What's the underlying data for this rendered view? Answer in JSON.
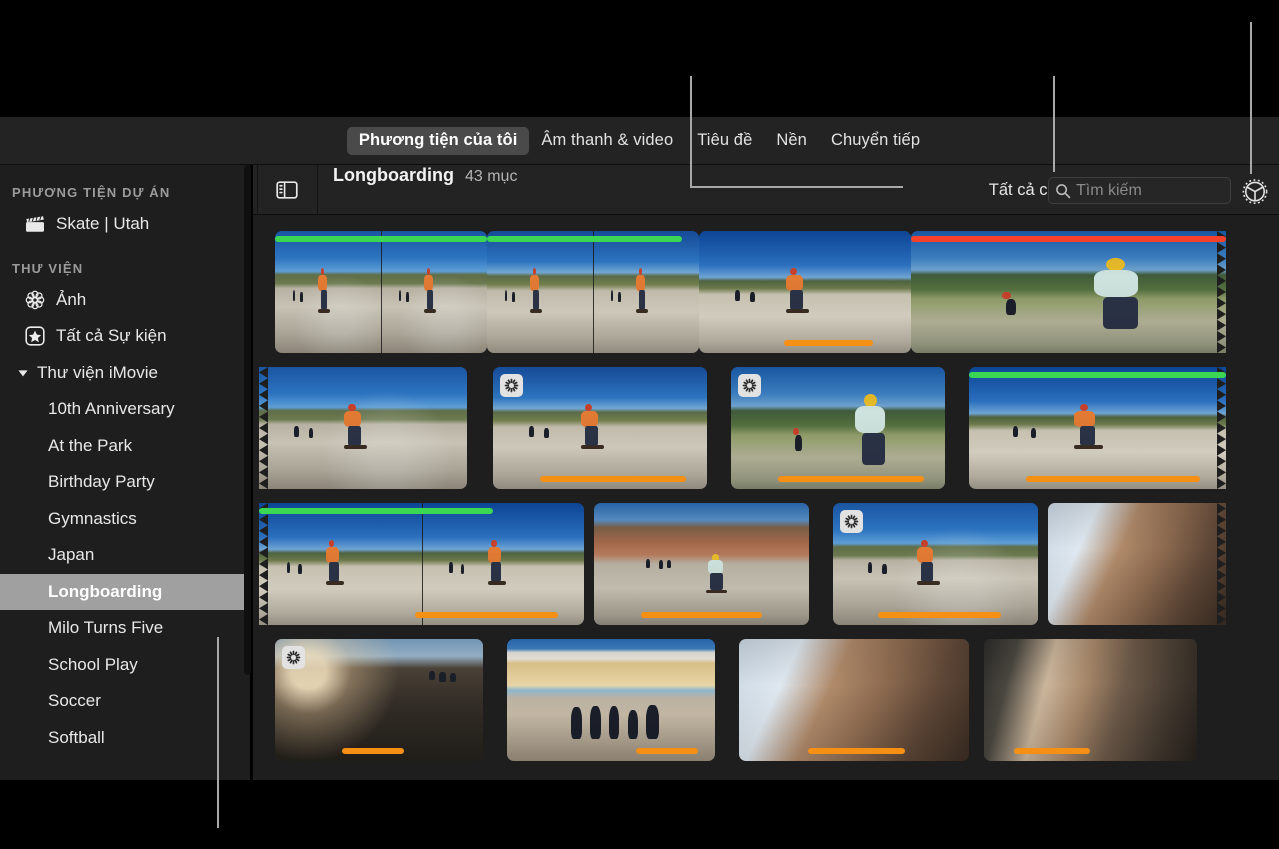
{
  "app": "iMovie media browser",
  "tab_bar": {
    "tabs": [
      {
        "label": "Phương tiện của tôi",
        "selected": true
      },
      {
        "label": "Âm thanh & video",
        "selected": false
      },
      {
        "label": "Tiêu đề",
        "selected": false
      },
      {
        "label": "Nền",
        "selected": false
      },
      {
        "label": "Chuyển tiếp",
        "selected": false
      }
    ]
  },
  "sidebar": {
    "sections": [
      {
        "header": "PHƯƠNG TIỆN DỰ ÁN",
        "items": [
          {
            "label": "Skate | Utah",
            "icon": "clapperboard-icon",
            "selected": false,
            "indent": "top"
          }
        ]
      },
      {
        "header": "THƯ VIỆN",
        "items": [
          {
            "label": "Ảnh",
            "icon": "photos-flower-icon",
            "selected": false,
            "indent": "top"
          },
          {
            "label": "Tất cả Sự kiện",
            "icon": "star-events-icon",
            "selected": false,
            "indent": "top"
          },
          {
            "label": "Thư viện iMovie",
            "icon": "disclosure-triangle-down-icon",
            "selected": false,
            "indent": "group"
          },
          {
            "label": "10th Anniversary",
            "icon": "",
            "selected": false,
            "indent": "child"
          },
          {
            "label": "At the Park",
            "icon": "",
            "selected": false,
            "indent": "child"
          },
          {
            "label": "Birthday Party",
            "icon": "",
            "selected": false,
            "indent": "child"
          },
          {
            "label": "Gymnastics",
            "icon": "",
            "selected": false,
            "indent": "child"
          },
          {
            "label": "Japan",
            "icon": "",
            "selected": false,
            "indent": "child"
          },
          {
            "label": "Longboarding",
            "icon": "",
            "selected": true,
            "indent": "child"
          },
          {
            "label": "Milo Turns Five",
            "icon": "",
            "selected": false,
            "indent": "child"
          },
          {
            "label": "School Play",
            "icon": "",
            "selected": false,
            "indent": "child"
          },
          {
            "label": "Soccer",
            "icon": "",
            "selected": false,
            "indent": "child"
          },
          {
            "label": "Softball",
            "icon": "",
            "selected": false,
            "indent": "child"
          }
        ]
      }
    ]
  },
  "browser_header": {
    "sidebar_toggle_icon": "sidebar-toggle-icon",
    "event_name": "Longboarding",
    "item_count": "43 mục",
    "filter_label": "Tất cả clip",
    "filter_stepper_icon": "stepper-up-down-icon",
    "search": {
      "icon": "search-icon",
      "placeholder": "Tìm kiếm",
      "value": ""
    },
    "settings_icon": "gear-icon"
  },
  "colors": {
    "favorite_bar": "#3ad654",
    "rejected_bar": "#f5402c",
    "keyword_bar": "#f59014",
    "selection": "#a0a0a0",
    "panel": "#1e1e1e",
    "chrome": "#232323",
    "callout": "#a8a8a8"
  },
  "scrollbars": {
    "browser_vertical": {
      "icon": "scrollbar-thumb",
      "position_percent": 8
    },
    "sidebar_vertical": {
      "icon": "scrollbar-thumb",
      "position_percent": 0
    }
  },
  "grid": {
    "rows": [
      {
        "clips": [
          {
            "pic": "sky-road",
            "segments": 2,
            "bars": [
              {
                "type": "green",
                "from": 0,
                "to": 100
              }
            ],
            "badge": "",
            "torn": ""
          },
          {
            "pic": "sky-road2",
            "segments": 2,
            "bars": [
              {
                "type": "green",
                "from": 0,
                "to": 92
              }
            ],
            "badge": "",
            "torn": ""
          },
          {
            "pic": "sky-road3",
            "segments": 1,
            "bars": [
              {
                "type": "orange",
                "from": 40,
                "to": 82
              }
            ],
            "badge": "",
            "torn": ""
          },
          {
            "pic": "greenhill",
            "segments": 1,
            "bars": [
              {
                "type": "red",
                "from": 0,
                "to": 100
              }
            ],
            "badge": "",
            "torn": "right"
          }
        ]
      },
      {
        "clips": [
          {
            "pic": "sky-road",
            "segments": 1,
            "bars": [],
            "badge": "",
            "torn": "left"
          },
          {
            "pic": "sky-road2",
            "segments": 1,
            "bars": [
              {
                "type": "orange",
                "from": 22,
                "to": 90
              }
            ],
            "badge": "analyze-icon",
            "torn": ""
          },
          {
            "pic": "greenhill",
            "segments": 1,
            "bars": [
              {
                "type": "orange",
                "from": 22,
                "to": 90
              }
            ],
            "badge": "analyze-icon",
            "torn": ""
          },
          {
            "pic": "sky-road3",
            "segments": 1,
            "bars": [
              {
                "type": "green",
                "from": 0,
                "to": 100
              },
              {
                "type": "orange",
                "from": 22,
                "to": 90
              }
            ],
            "badge": "",
            "torn": "right"
          }
        ]
      },
      {
        "clips": [
          {
            "pic": "sky-road3",
            "segments": 2,
            "bars": [
              {
                "type": "green",
                "from": 0,
                "to": 72
              },
              {
                "type": "orange",
                "from": 48,
                "to": 92
              }
            ],
            "badge": "",
            "torn": "left"
          },
          {
            "pic": "red-rock",
            "segments": 1,
            "bars": [
              {
                "type": "orange",
                "from": 22,
                "to": 78
              }
            ],
            "badge": "",
            "torn": ""
          },
          {
            "pic": "sky-road",
            "segments": 1,
            "bars": [
              {
                "type": "orange",
                "from": 22,
                "to": 82
              }
            ],
            "badge": "analyze-icon",
            "torn": ""
          },
          {
            "pic": "carface",
            "segments": 1,
            "bars": [],
            "badge": "",
            "torn": "right"
          }
        ]
      },
      {
        "clips": [
          {
            "pic": "dusk",
            "segments": 1,
            "bars": [
              {
                "type": "orange",
                "from": 32,
                "to": 62
              }
            ],
            "badge": "analyze-icon",
            "torn": ""
          },
          {
            "pic": "building",
            "segments": 1,
            "bars": [
              {
                "type": "orange",
                "from": 62,
                "to": 92
              }
            ],
            "badge": "",
            "torn": ""
          },
          {
            "pic": "carface",
            "segments": 1,
            "bars": [
              {
                "type": "orange",
                "from": 30,
                "to": 72
              }
            ],
            "badge": "",
            "torn": ""
          },
          {
            "pic": "carface2",
            "segments": 1,
            "bars": [
              {
                "type": "orange",
                "from": 14,
                "to": 50
              }
            ],
            "badge": "",
            "torn": ""
          }
        ]
      }
    ]
  },
  "annotations": {
    "callouts": [
      {
        "name": "filter-callout",
        "target": "Tất cả clip"
      },
      {
        "name": "search-callout",
        "target": "Tìm kiếm"
      },
      {
        "name": "settings-callout",
        "target": "gear"
      },
      {
        "name": "sidebar-callout",
        "target": "Longboarding"
      }
    ]
  }
}
